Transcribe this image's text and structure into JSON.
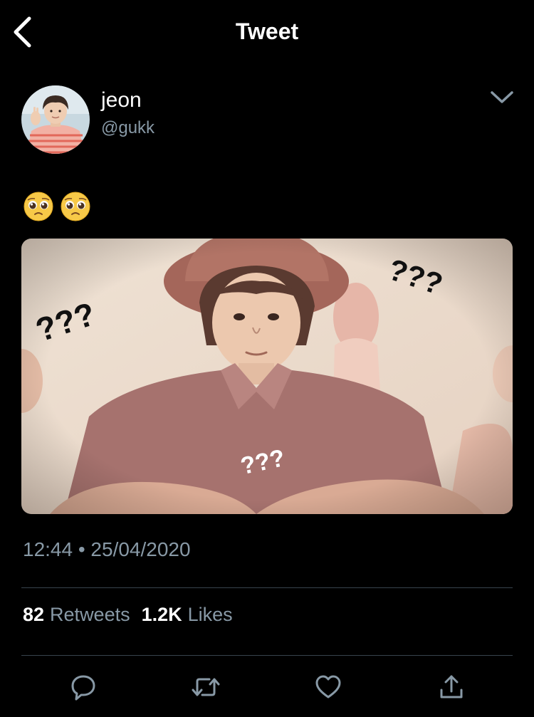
{
  "header": {
    "title": "Tweet",
    "back_icon": "chevron-left-icon"
  },
  "tweet": {
    "author_name": "jeon",
    "author_handle": "@gukk",
    "text_emojis": [
      "pleading-face-emoji",
      "pleading-face-emoji"
    ],
    "image_overlay_text": [
      "???",
      "???",
      "???"
    ],
    "timestamp": "12:44 • 25/04/2020",
    "retweets_count": "82",
    "retweets_label": "Retweets",
    "likes_count": "1.2K",
    "likes_label": "Likes"
  },
  "actions": [
    "reply-icon",
    "retweet-icon",
    "like-icon",
    "share-icon"
  ],
  "colors": {
    "background": "#000000",
    "text": "#ffffff",
    "secondary": "#8899a6",
    "divider": "#38444d"
  }
}
